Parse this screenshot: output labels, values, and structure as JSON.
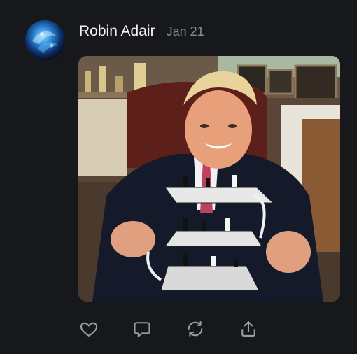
{
  "post": {
    "author": "Robin Adair",
    "date": "Jan 21"
  },
  "icons": {
    "avatar": "avatar-image",
    "like": "heart-icon",
    "reply": "comment-icon",
    "repost": "repost-icon",
    "share": "share-icon"
  },
  "colors": {
    "background": "#17181c",
    "text_primary": "#f2f2f4",
    "text_secondary": "#8b8d96",
    "icon": "#9a9ca4"
  }
}
